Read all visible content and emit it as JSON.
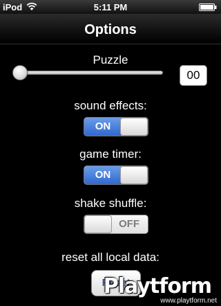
{
  "status_bar": {
    "carrier": "iPod",
    "time": "5:11 PM"
  },
  "nav": {
    "title": "Options"
  },
  "puzzle": {
    "label": "Puzzle",
    "value_display": "00",
    "slider_fraction": 0
  },
  "sound_effects": {
    "label": "sound effects:",
    "state": "ON"
  },
  "game_timer": {
    "label": "game timer:",
    "state": "ON"
  },
  "shake_shuffle": {
    "label": "shake shuffle:",
    "state": "OFF"
  },
  "reset": {
    "label": "reset all local data:",
    "button_label": "Reset"
  },
  "watermark": {
    "logo_text": "Playtform",
    "url": "www.playtform.net"
  },
  "colors": {
    "toggle_on": "#2f68cf",
    "background": "#000000"
  }
}
